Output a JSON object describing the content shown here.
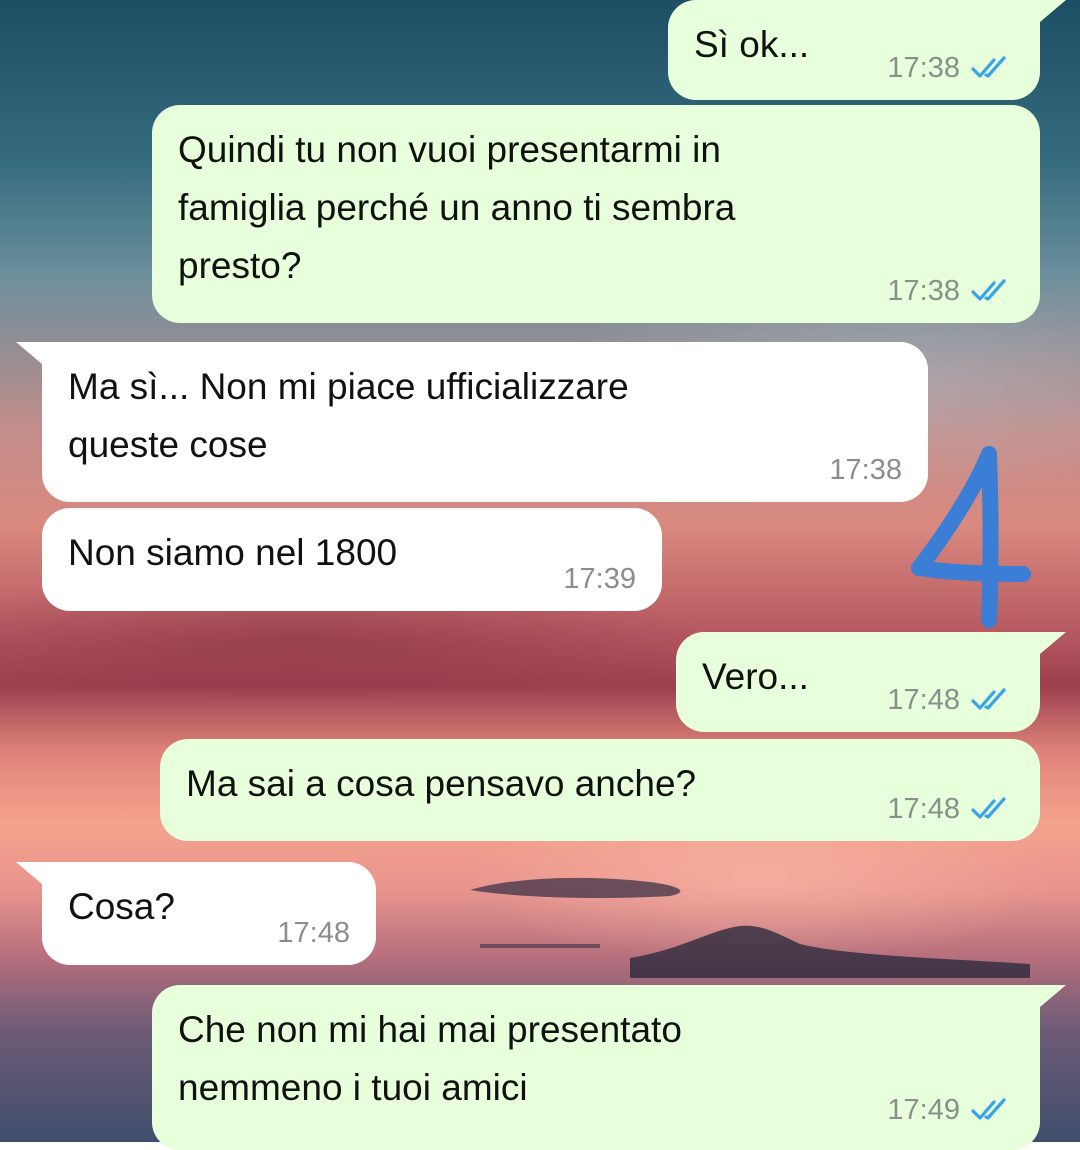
{
  "colors": {
    "outgoing_bubble": "#e7ffdb",
    "incoming_bubble": "#ffffff",
    "read_ticks": "#3aa3e8",
    "annotation": "#3b7ed6"
  },
  "annotation": {
    "text": "4"
  },
  "messages": [
    {
      "direction": "outgoing",
      "text": "Sì ok...",
      "time": "17:38",
      "status": "read"
    },
    {
      "direction": "outgoing",
      "text": "Quindi tu non vuoi presentarmi in\nfamiglia perché un anno ti sembra\npresto?",
      "time": "17:38",
      "status": "read"
    },
    {
      "direction": "incoming",
      "text": "Ma sì... Non mi piace ufficializzare\nqueste cose",
      "time": "17:38"
    },
    {
      "direction": "incoming",
      "text": "Non siamo nel 1800",
      "time": "17:39"
    },
    {
      "direction": "outgoing",
      "text": "Vero...",
      "time": "17:48",
      "status": "read"
    },
    {
      "direction": "outgoing",
      "text": "Ma sai a cosa pensavo anche?",
      "time": "17:48",
      "status": "read"
    },
    {
      "direction": "incoming",
      "text": "Cosa?",
      "time": "17:48"
    },
    {
      "direction": "outgoing",
      "text": "Che non mi hai mai presentato\nnemmeno i tuoi amici",
      "time": "17:49",
      "status": "read"
    }
  ]
}
